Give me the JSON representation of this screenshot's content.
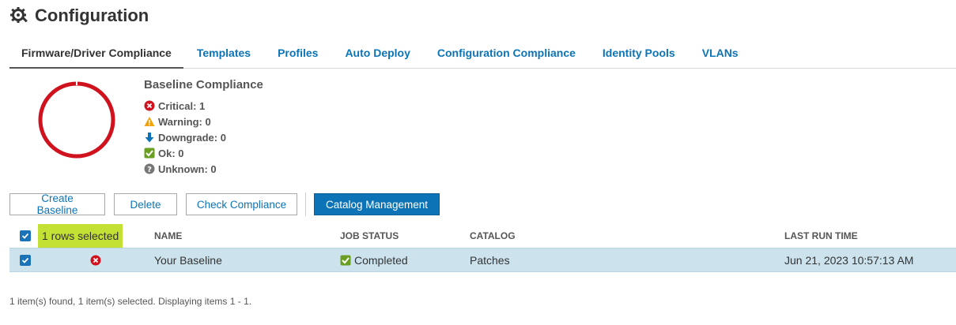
{
  "page": {
    "title": "Configuration",
    "icon": "gear-wrench-icon"
  },
  "tabs": [
    {
      "label": "Firmware/Driver Compliance",
      "active": true
    },
    {
      "label": "Templates"
    },
    {
      "label": "Profiles"
    },
    {
      "label": "Auto Deploy"
    },
    {
      "label": "Configuration Compliance"
    },
    {
      "label": "Identity Pools"
    },
    {
      "label": "VLANs"
    }
  ],
  "compliance": {
    "title": "Baseline Compliance",
    "critical_ratio": 1,
    "stats": [
      {
        "label": "Critical: 1",
        "icon": "critical-x-icon"
      },
      {
        "label": "Warning: 0",
        "icon": "warning-triangle-icon"
      },
      {
        "label": "Downgrade: 0",
        "icon": "downgrade-arrow-icon"
      },
      {
        "label": "Ok: 0",
        "icon": "ok-check-icon"
      },
      {
        "label": "Unknown: 0",
        "icon": "unknown-question-icon"
      }
    ]
  },
  "toolbar": {
    "create": "Create Baseline",
    "delete": "Delete",
    "check": "Check Compliance",
    "catalog": "Catalog Management"
  },
  "table": {
    "selected_text": "1 rows selected",
    "columns": [
      "NAME",
      "JOB STATUS",
      "CATALOG",
      "LAST RUN TIME"
    ],
    "rows": [
      {
        "name": "Your Baseline",
        "status": "Completed",
        "catalog": "Patches",
        "last_run": "Jun 21, 2023 10:57:13 AM",
        "selected": true,
        "compliance": "critical"
      }
    ]
  },
  "footer": "1 item(s) found, 1 item(s) selected. Displaying items 1 - 1.",
  "colors": {
    "accent": "#0c74b6",
    "critical": "#d0121f",
    "warning": "#f0a30a",
    "ok": "#6a9f22",
    "unknown": "#777777",
    "selection": "#c3e034",
    "row_selected": "#cce3ee"
  }
}
